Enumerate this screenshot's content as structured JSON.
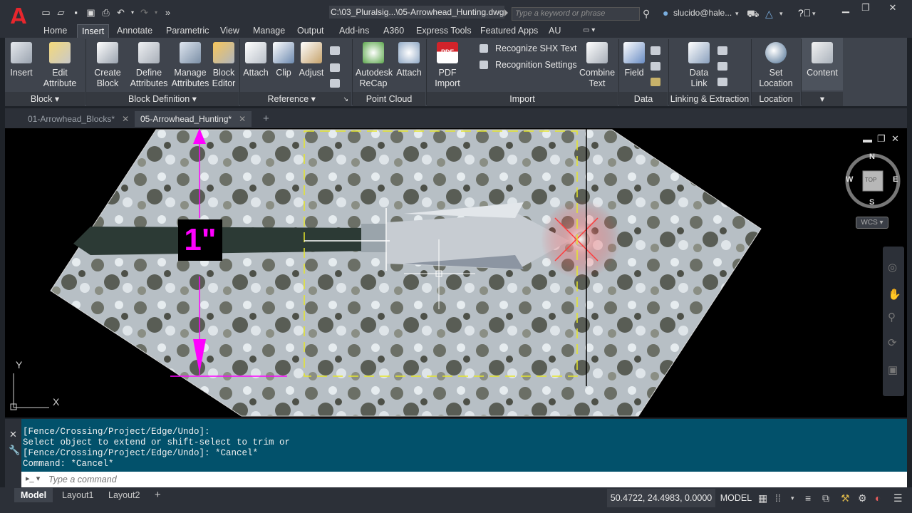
{
  "titlebar": {
    "file_title": "C:\\03_Pluralsig...\\05-Arrowhead_Hunting.dwg",
    "search_placeholder": "Type a keyword or phrase",
    "user": "slucido@hale..."
  },
  "ribbon_tabs": [
    "Home",
    "Insert",
    "Annotate",
    "Parametric",
    "View",
    "Manage",
    "Output",
    "Add-ins",
    "A360",
    "Express Tools",
    "Featured Apps",
    "AU"
  ],
  "active_tab": "Insert",
  "ribbon": {
    "insert": "Insert",
    "edit_attribute": [
      "Edit",
      "Attribute"
    ],
    "create_block": [
      "Create",
      "Block"
    ],
    "define_attributes": [
      "Define",
      "Attributes"
    ],
    "manage_attributes": [
      "Manage",
      "Attributes"
    ],
    "block_editor": [
      "Block",
      "Editor"
    ],
    "attach": "Attach",
    "clip": "Clip",
    "adjust": "Adjust",
    "autodesk_recap": [
      "Autodesk",
      "ReCap"
    ],
    "attach_pc": "Attach",
    "pdf_import": [
      "PDF",
      "Import"
    ],
    "recognize_shx": "Recognize SHX Text",
    "recognition_settings": "Recognition Settings",
    "combine_text": [
      "Combine",
      "Text"
    ],
    "field": "Field",
    "data_link": [
      "Data",
      "Link"
    ],
    "set_location": [
      "Set",
      "Location"
    ],
    "content": "Content",
    "panels": {
      "block": "Block",
      "block_definition": "Block Definition",
      "reference": "Reference",
      "point_cloud": "Point Cloud",
      "import": "Import",
      "data": "Data",
      "linking": "Linking & Extraction",
      "location": "Location"
    }
  },
  "file_tabs": [
    "01-Arrowhead_Blocks*",
    "05-Arrowhead_Hunting*"
  ],
  "drawing": {
    "dimension_text": "1\"",
    "compass": {
      "n": "N",
      "s": "S",
      "e": "E",
      "w": "W",
      "top": "TOP"
    },
    "wcs": "WCS",
    "ucs_x": "X",
    "ucs_y": "Y"
  },
  "command": {
    "lines": [
      "[Fence/Crossing/Project/Edge/Undo]:",
      "Select object to extend or shift-select to trim or",
      "[Fence/Crossing/Project/Edge/Undo]: *Cancel*",
      "Command: *Cancel*"
    ],
    "placeholder": "Type a command"
  },
  "status": {
    "layouts": [
      "Model",
      "Layout1",
      "Layout2"
    ],
    "coords": "50.4722, 24.4983, 0.0000",
    "model": "MODEL"
  }
}
